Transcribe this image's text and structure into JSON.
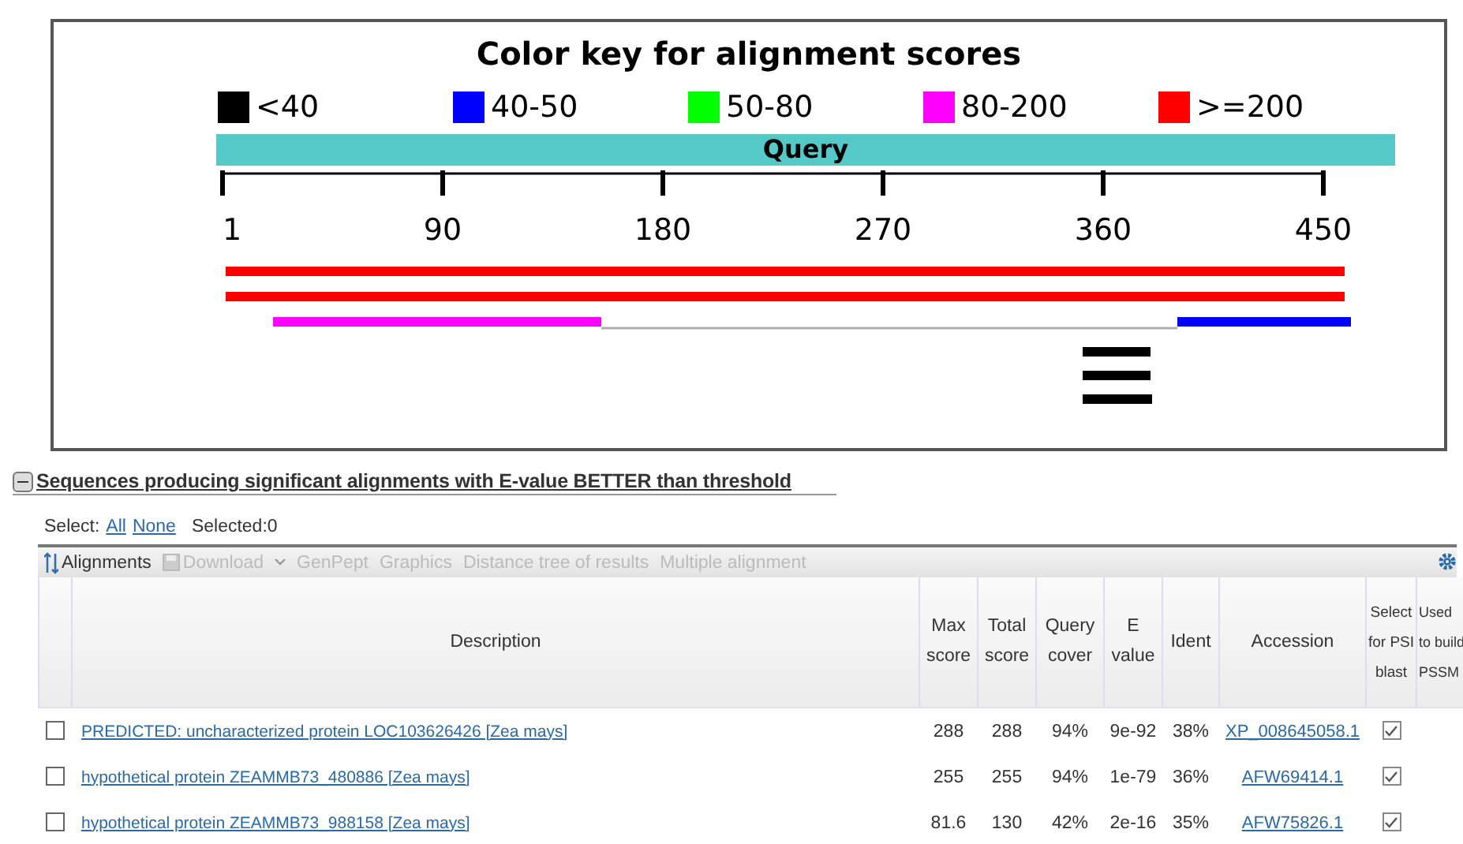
{
  "graphic": {
    "title": "Color key for alignment scores",
    "key": [
      {
        "label": "<40",
        "color": "#000000"
      },
      {
        "label": "40-50",
        "color": "#0000ff"
      },
      {
        "label": "50-80",
        "color": "#00ff00"
      },
      {
        "label": "80-200",
        "color": "#ff00ff"
      },
      {
        "label": ">=200",
        "color": "#ff0000"
      }
    ],
    "query_label": "Query",
    "ticks": [
      "1",
      "90",
      "180",
      "270",
      "360",
      "450"
    ]
  },
  "section": {
    "title": "Sequences producing significant alignments with E-value BETTER than threshold",
    "expanded": true
  },
  "select": {
    "label": "Select:",
    "links": [
      "All",
      "None"
    ],
    "selected": "Selected:0"
  },
  "toolbar": [
    {
      "label": "Alignments",
      "disabled": false
    },
    {
      "label": "Download",
      "disabled": true
    },
    {
      "label": "GenPept",
      "disabled": true
    },
    {
      "label": "Graphics",
      "disabled": true
    },
    {
      "label": "Distance tree of results",
      "disabled": true
    },
    {
      "label": "Multiple alignment",
      "disabled": true
    }
  ],
  "table": {
    "columns": [
      "Description",
      "Max score",
      "Total score",
      "Query cover",
      "E value",
      "Ident",
      "Accession",
      "Select for PSI blast",
      "Used to build PSSM"
    ],
    "rows": [
      {
        "checked": false,
        "description": "PREDICTED: uncharacterized protein LOC103626426 [Zea mays]",
        "max": "288",
        "total": "288",
        "cover": "94%",
        "evalue": "9e-92",
        "ident": "38%",
        "accession": "XP_008645058.1",
        "psi": true
      },
      {
        "checked": false,
        "description": "hypothetical protein ZEAMMB73_480886 [Zea mays]",
        "max": "255",
        "total": "255",
        "cover": "94%",
        "evalue": "1e-79",
        "ident": "36%",
        "accession": "AFW69414.1",
        "psi": true
      },
      {
        "checked": false,
        "description": "hypothetical protein ZEAMMB73_988158 [Zea mays]",
        "max": "81.6",
        "total": "130",
        "cover": "42%",
        "evalue": "2e-16",
        "ident": "35%",
        "accession": "AFW75826.1",
        "psi": true
      }
    ]
  }
}
